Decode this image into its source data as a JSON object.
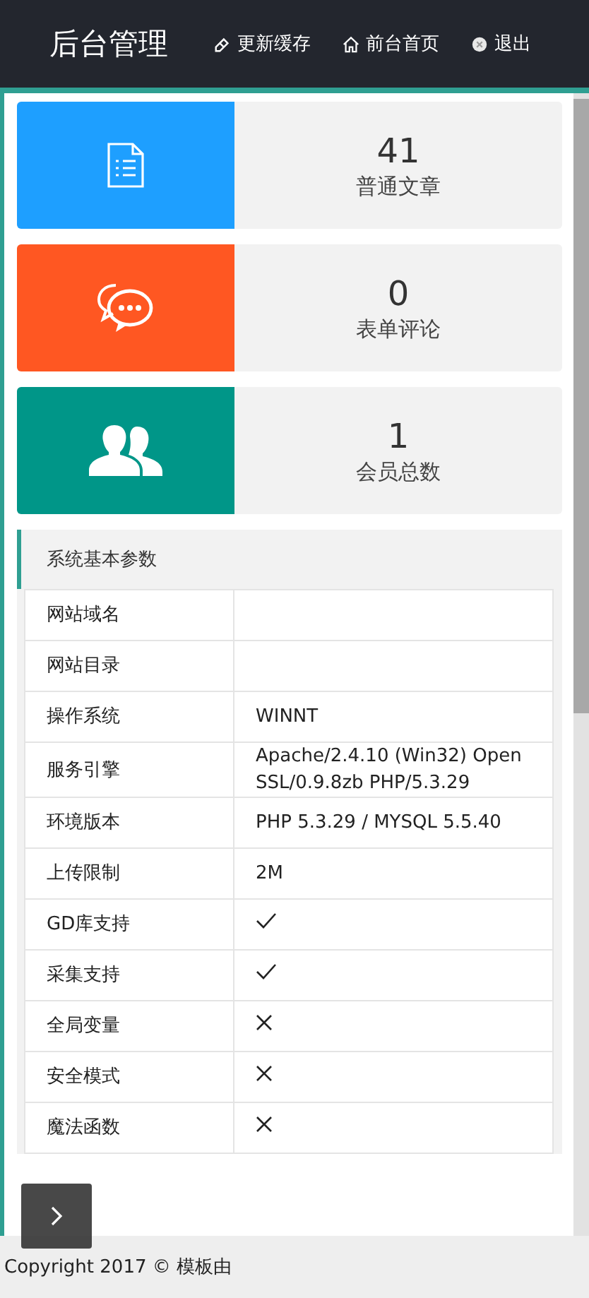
{
  "header": {
    "title": "后台管理",
    "nav": [
      {
        "label": "更新缓存",
        "kind": "eraser"
      },
      {
        "label": "前台首页",
        "kind": "home"
      },
      {
        "label": "退出",
        "kind": "exit"
      }
    ]
  },
  "stats": [
    {
      "value": "41",
      "label": "普通文章",
      "kind": "document",
      "color": "#1e9fff"
    },
    {
      "value": "0",
      "label": "表单评论",
      "kind": "chat",
      "color": "#ff5722"
    },
    {
      "value": "1",
      "label": "会员总数",
      "kind": "users",
      "color": "#009688"
    }
  ],
  "panel": {
    "title": "系统基本参数",
    "rows": [
      {
        "label": "网站域名",
        "kind": "text",
        "value": ""
      },
      {
        "label": "网站目录",
        "kind": "text",
        "value": ""
      },
      {
        "label": "操作系统",
        "kind": "text",
        "value": "WINNT"
      },
      {
        "label": "服务引擎",
        "kind": "text",
        "value": "Apache/2.4.10 (Win32) OpenSSL/0.9.8zb PHP/5.3.29"
      },
      {
        "label": "环境版本",
        "kind": "text",
        "value": "PHP 5.3.29 / MYSQL 5.5.40"
      },
      {
        "label": "上传限制",
        "kind": "text",
        "value": "2M"
      },
      {
        "label": "GD库支持",
        "kind": "check"
      },
      {
        "label": "采集支持",
        "kind": "check"
      },
      {
        "label": "全局变量",
        "kind": "cross"
      },
      {
        "label": "安全模式",
        "kind": "cross"
      },
      {
        "label": "魔法函数",
        "kind": "cross"
      }
    ]
  },
  "footer": {
    "text": "Copyright 2017 © 模板由"
  }
}
